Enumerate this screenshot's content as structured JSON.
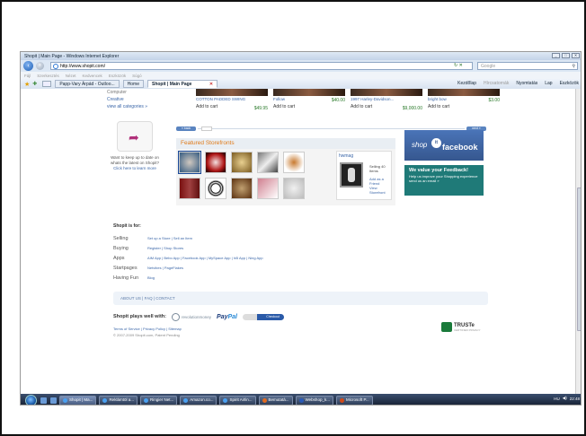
{
  "window": {
    "title": "Shopit | Main Page - Windows Internet Explorer",
    "controls": [
      "_",
      "□",
      "✕"
    ]
  },
  "addressbar": {
    "url": "http://www.shopit.com/",
    "search_placeholder": "Google"
  },
  "menubar": [
    "Fájl",
    "Szerkesztés",
    "Nézet",
    "Kedvencek",
    "Eszközök",
    "Súgó"
  ],
  "tabs": {
    "items": [
      {
        "label": "Papp-Vary Árpád - Outloo..."
      },
      {
        "label": "Home"
      },
      {
        "label": "Shopit | Main Page",
        "active": true
      }
    ],
    "commands": [
      "Kezdőlap",
      "Hírcsatornák",
      "Nyomtatás",
      "Lap",
      "Eszközök"
    ]
  },
  "left_links": [
    "Computer",
    "Creative",
    "view all categories »"
  ],
  "products": [
    {
      "name": "COTTON PADDED SWING",
      "price": "",
      "add": "Add to cart",
      "price2": "$49.95"
    },
    {
      "name": "Follow",
      "price": "$40.00",
      "add": "Add to cart",
      "price2": ""
    },
    {
      "name": "1997 Harley-Davidson...",
      "price": "",
      "add": "Add to cart",
      "price2": "$9,000.00"
    },
    {
      "name": "bright bow",
      "price": "$3.00",
      "add": "Add to cart",
      "price2": ""
    }
  ],
  "share": {
    "text": "Want to keep up to date on whats the latest on Shopit?",
    "link": "Click here to learn more"
  },
  "pager": {
    "back": "« back",
    "next": "next »"
  },
  "featured": {
    "title": "Featured Storefronts",
    "store_name": "hwmag",
    "items_text": "Selling 40 Items",
    "add_friend": "Add as a Friend",
    "view_store": "View Storefront"
  },
  "facebook": {
    "shop": "shop",
    "it": "it",
    "fb": "facebook"
  },
  "feedback": {
    "title": "We value your Feedback!",
    "subtitle": "Help us improve your Shopping experience send us an email »"
  },
  "footer": {
    "title": "Shopit is for:",
    "rows": [
      {
        "label": "Selling",
        "links": "Set up a Store  |  Sell an Item"
      },
      {
        "label": "Buying",
        "links": "Register  |  Shop Stores"
      },
      {
        "label": "Apps",
        "links": "AIM App  |  Bebo App  |  Facebook App  |  MySpace App  |  hi5 App  |  Ning App"
      },
      {
        "label": "Startpages",
        "links": "Netvibes  |  PageFlakes"
      },
      {
        "label": "Having Fun",
        "links": "Blog"
      }
    ],
    "about": "ABOUT US   |   FAQ   |   CONTACT",
    "plays_well": "Shopit plays well with:",
    "revmoney": "revolutionmoney",
    "paypal_a": "Pay",
    "paypal_b": "Pal",
    "gcheckout": "Checkout",
    "tos": "Terms of Service   |   Privacy Policy   |   Sitemap",
    "copyright": "© 2007-2009 Shopit.com, Patent Pending",
    "truste": "TRUSTe",
    "truste_sub": "CERTIFIED PRIVACY"
  },
  "taskbar": {
    "buttons": [
      {
        "label": "Shopit | Ma..."
      },
      {
        "label": "Reklámtöl a..."
      },
      {
        "label": "Ringier Net..."
      },
      {
        "label": "Amazon.co..."
      },
      {
        "label": "Spirit Airlin..."
      },
      {
        "label": "Bemutatá..."
      },
      {
        "label": "Webshop_k..."
      },
      {
        "label": "Microsoft P..."
      }
    ],
    "lang": "HU",
    "time": "22:48"
  }
}
